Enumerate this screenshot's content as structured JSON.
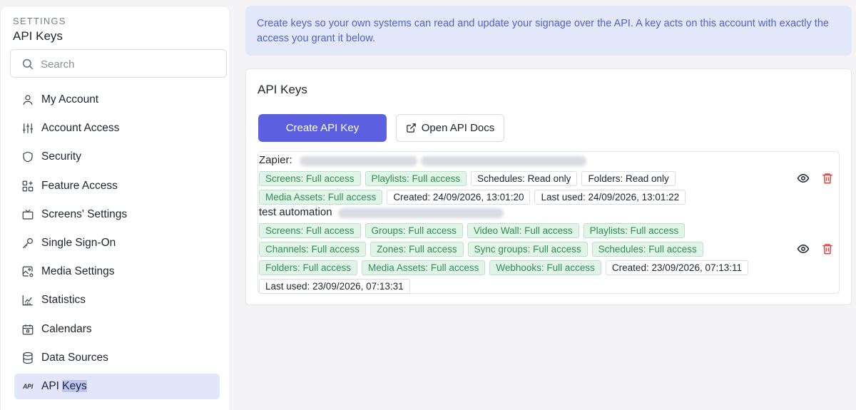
{
  "sidebar": {
    "overline": "SETTINGS",
    "title": "API Keys",
    "search_placeholder": "Search",
    "items": [
      {
        "label": "My Account",
        "icon": "user-icon"
      },
      {
        "label": "Account Access",
        "icon": "sliders-icon"
      },
      {
        "label": "Security",
        "icon": "shield-icon"
      },
      {
        "label": "Feature Access",
        "icon": "grid-plus-icon"
      },
      {
        "label": "Screens' Settings",
        "icon": "tv-icon"
      },
      {
        "label": "Single Sign-On",
        "icon": "key-icon"
      },
      {
        "label": "Media Settings",
        "icon": "image-settings-icon"
      },
      {
        "label": "Statistics",
        "icon": "chart-icon"
      },
      {
        "label": "Calendars",
        "icon": "calendar-icon"
      },
      {
        "label": "Data Sources",
        "icon": "database-icon"
      }
    ],
    "active_item": {
      "label_a": "API ",
      "label_b": "Keys",
      "icon_text": "API"
    }
  },
  "banner": {
    "text": "Create keys so your own systems can read and update your signage over the API. A key acts on this account with exactly the access you grant it below."
  },
  "card": {
    "title": "API Keys",
    "create_label": "Create API Key",
    "docs_label": "Open API Docs"
  },
  "keys": [
    {
      "name": "Zapier:",
      "rows": [
        [
          {
            "t": "Screens: Full access",
            "g": true
          },
          {
            "t": "Playlists: Full access",
            "g": true
          },
          {
            "t": "Schedules: Read only",
            "g": false
          },
          {
            "t": "Folders: Read only",
            "g": false
          }
        ],
        [
          {
            "t": "Media Assets: Full access",
            "g": true
          },
          {
            "t": "Created: 24/09/2026, 13:01:20",
            "g": false
          },
          {
            "t": "Last used: 24/09/2026, 13:01:22",
            "g": false
          }
        ]
      ]
    },
    {
      "name": "test automation",
      "rows": [
        [
          {
            "t": "Screens: Full access",
            "g": true
          },
          {
            "t": "Groups: Full access",
            "g": true
          },
          {
            "t": "Video Wall: Full access",
            "g": true
          },
          {
            "t": "Playlists: Full access",
            "g": true
          }
        ],
        [
          {
            "t": "Channels: Full access",
            "g": true
          },
          {
            "t": "Zones: Full access",
            "g": true
          },
          {
            "t": "Sync groups: Full access",
            "g": true
          },
          {
            "t": "Schedules: Full access",
            "g": true
          }
        ],
        [
          {
            "t": "Folders: Full access",
            "g": true
          },
          {
            "t": "Media Assets: Full access",
            "g": true
          },
          {
            "t": "Webhooks: Full access",
            "g": true
          },
          {
            "t": "Created: 23/09/2026, 07:13:11",
            "g": false
          }
        ],
        [
          {
            "t": "Last used: 23/09/2026, 07:13:31",
            "g": false
          }
        ]
      ]
    }
  ],
  "colors": {
    "accent": "#5b5fe0",
    "tag_green": "#2c8f53",
    "delete_red": "#e04545"
  }
}
